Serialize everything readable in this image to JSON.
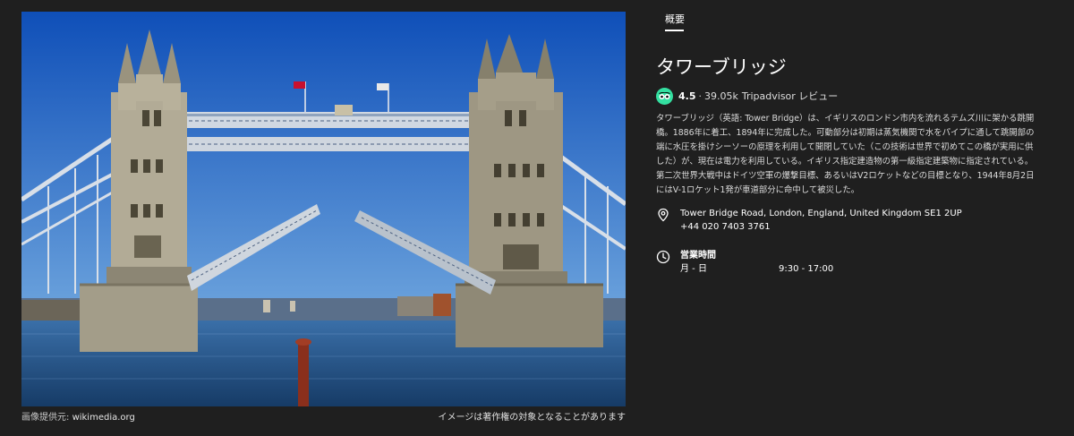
{
  "image": {
    "credit_label": "画像提供元: ",
    "credit_source": "wikimedia.org",
    "copyright_notice": "イメージは著作権の対象となることがあります",
    "sky_color": "#1a5fc0",
    "water_color": "#1f4f8a",
    "stone_color": "#a8a28e"
  },
  "panel": {
    "tab_label": "概要",
    "title": "タワーブリッジ",
    "rating": {
      "score": "4.5",
      "separator": "·",
      "count": "39.05k",
      "source": "Tripadvisor レビュー",
      "logo_color": "#34e0a1"
    },
    "description": "タワーブリッジ（英語: Tower Bridge）は、イギリスのロンドン市内を流れるテムズ川に架かる跳開橋。1886年に着工、1894年に完成した。可動部分は初期は蒸気機関で水をパイプに通して跳開部の端に水圧を掛けシーソーの原理を利用して開閉していた（この技術は世界で初めてこの橋が実用に供した）が、現在は電力を利用している。イギリス指定建造物の第一級指定建築物に指定されている。第二次世界大戦中はドイツ空軍の爆撃目標、あるいはV2ロケットなどの目標となり、1944年8月2日にはV-1ロケット1発が車道部分に命中して被災した。",
    "address": "Tower Bridge Road, London, England, United Kingdom SE1 2UP",
    "phone": "+44 020 7403 3761",
    "hours": {
      "title": "営業時間",
      "day": "月 - 日",
      "time": "9:30 - 17:00"
    }
  },
  "icons": [
    "location-pin-icon",
    "clock-icon",
    "tripadvisor-logo-icon"
  ]
}
